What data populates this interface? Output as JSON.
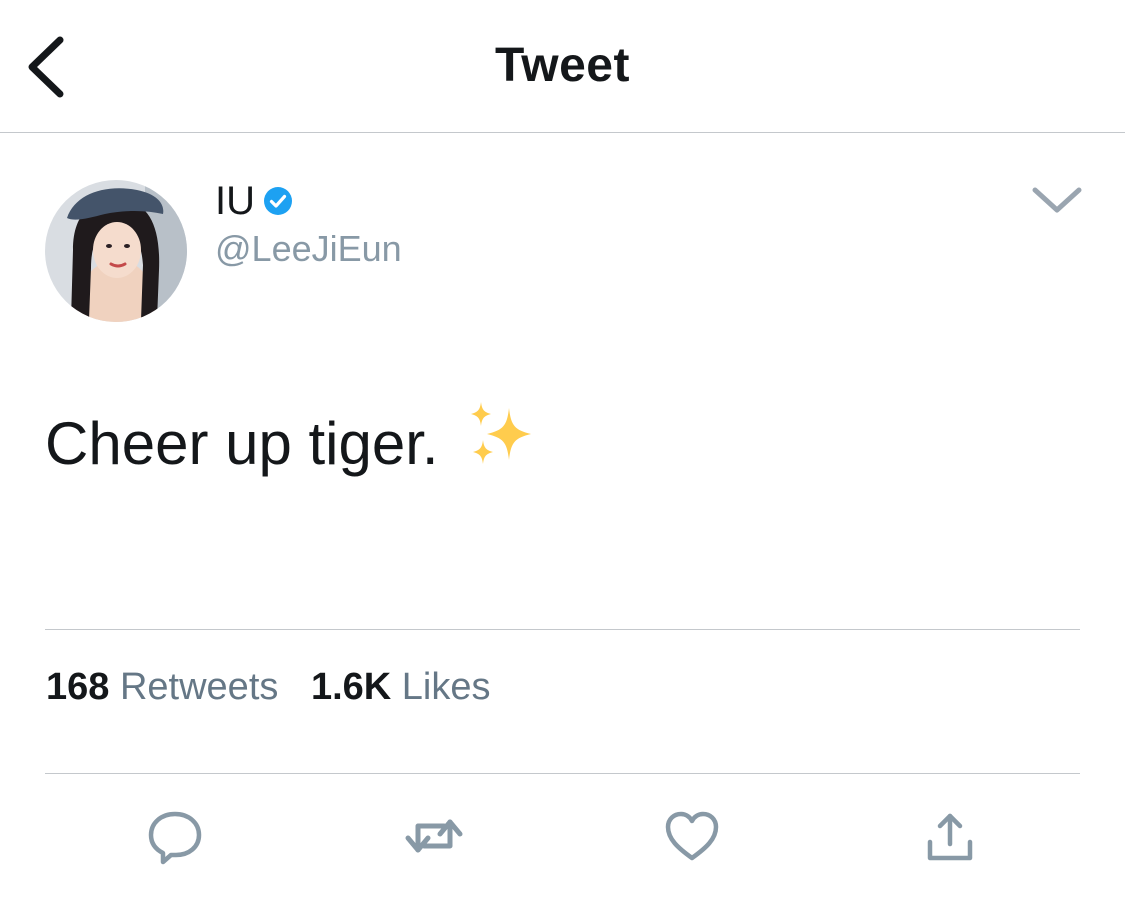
{
  "header": {
    "title": "Tweet",
    "back_icon": "chevron-left-icon"
  },
  "author": {
    "name": "IU",
    "handle": "@LeeJiEun",
    "verified": true,
    "verified_icon": "verified-badge-icon",
    "menu_icon": "chevron-down-icon"
  },
  "tweet": {
    "text": "Cheer up tiger.",
    "emoji": "sparkles-icon"
  },
  "stats": {
    "retweets_count": "168",
    "retweets_label": "Retweets",
    "likes_count": "1.6K",
    "likes_label": "Likes"
  },
  "actions": [
    "reply-icon",
    "retweet-icon",
    "like-icon",
    "share-icon"
  ],
  "colors": {
    "verified": "#1da1f2",
    "muted": "#657786",
    "sparkle": "#ffcc4d",
    "divider": "#c4c8cc"
  }
}
